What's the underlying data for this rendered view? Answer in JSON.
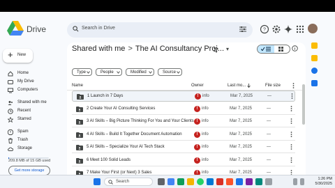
{
  "app": {
    "brand": "Drive"
  },
  "search": {
    "placeholder": "Search in Drive"
  },
  "sidebar": {
    "new_label": "New",
    "items": [
      {
        "label": "Home",
        "icon": "home-icon"
      },
      {
        "label": "My Drive",
        "icon": "my-drive-icon"
      },
      {
        "label": "Computers",
        "icon": "computers-icon"
      },
      {
        "label": "Shared with me",
        "icon": "shared-icon"
      },
      {
        "label": "Recent",
        "icon": "clock-icon"
      },
      {
        "label": "Starred",
        "icon": "star-icon"
      },
      {
        "label": "Spam",
        "icon": "spam-icon"
      },
      {
        "label": "Trash",
        "icon": "trash-icon"
      },
      {
        "label": "Storage",
        "icon": "cloud-icon"
      }
    ],
    "storage_text": "209.8 MB of 15 GB used",
    "storage_fraction": 0.014,
    "get_more": "Get more storage"
  },
  "breadcrumb": {
    "root": "Shared with me",
    "separator": ">",
    "current": "The AI Consultancy Proj..."
  },
  "filters": [
    "Type",
    "People",
    "Modified",
    "Source"
  ],
  "table": {
    "headers": {
      "name": "Name",
      "owner": "Owner",
      "modified": "Last mo...",
      "size": "File size"
    },
    "rows": [
      {
        "name": "1 Launch in 7 Days",
        "owner": "info",
        "modified": "Mar 7, 2025",
        "size": "—"
      },
      {
        "name": "2 Create Your AI Consulting Services",
        "owner": "info",
        "modified": "Mar 7, 2025",
        "size": "—"
      },
      {
        "name": "3 AI Skills – Big Picture Thinking For You and Your Clients",
        "owner": "info",
        "modified": "Mar 7, 2025",
        "size": "—"
      },
      {
        "name": "4 AI Skills – Build It Together Document Automation",
        "owner": "info",
        "modified": "Mar 7, 2025",
        "size": "—"
      },
      {
        "name": "5 AI Skills – Specialize Your AI Tech Stack",
        "owner": "info",
        "modified": "Mar 7, 2025",
        "size": "—"
      },
      {
        "name": "6 Meet 100 Solid Leads",
        "owner": "info",
        "modified": "Mar 7, 2025",
        "size": "—"
      },
      {
        "name": "7 Make Your First (or Next) 3 Sales",
        "owner": "info",
        "modified": "Mar 7, 2025",
        "size": "—"
      }
    ]
  },
  "taskbar": {
    "search_label": "Search",
    "time": "1:26 PM",
    "date": "5/30/2025"
  },
  "colors": {
    "accent": "#0b57d0",
    "owner_badge": "#c5221f",
    "selected_toggle": "#c2e7ff"
  }
}
